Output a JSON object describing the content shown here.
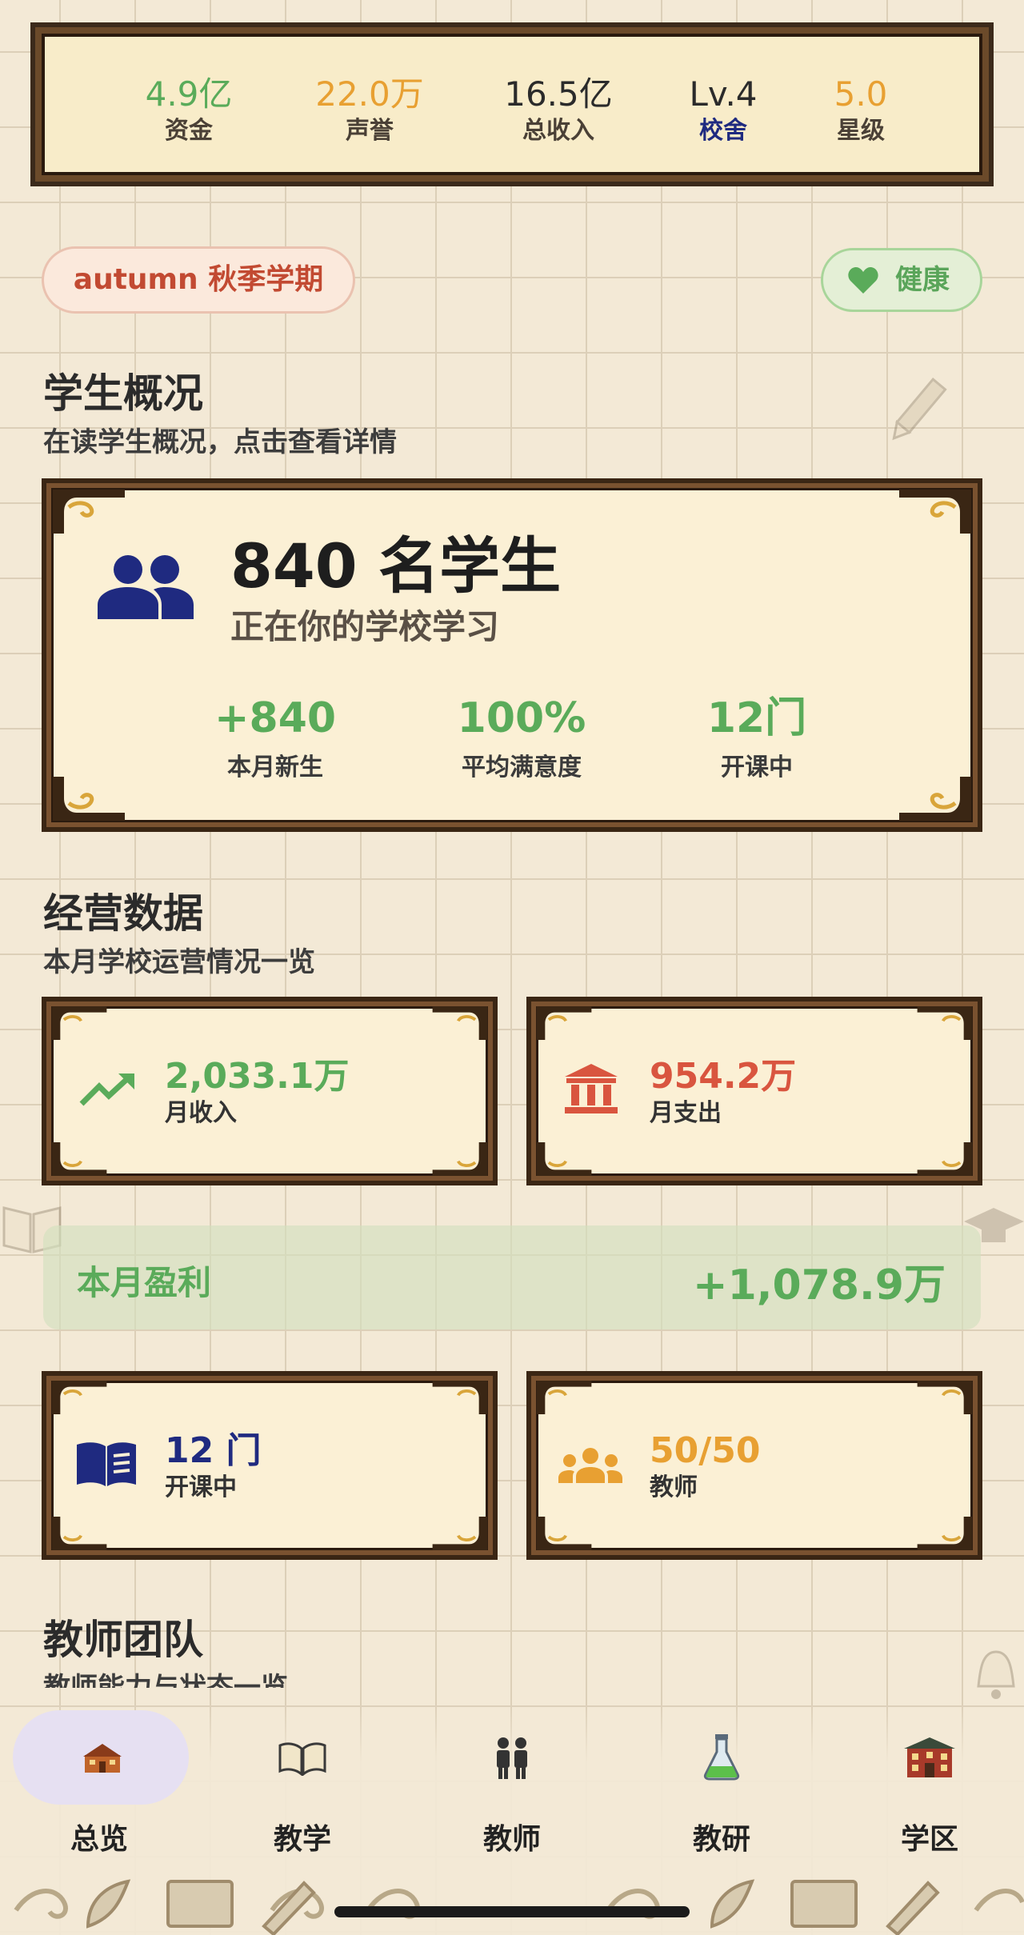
{
  "stats": [
    {
      "value": "4.9亿",
      "label": "资金",
      "value_color": "#5aab5a",
      "label_color": "#4a4036"
    },
    {
      "value": "22.0万",
      "label": "声誉",
      "value_color": "#e8a032",
      "label_color": "#4a4036"
    },
    {
      "value": "16.5亿",
      "label": "总收入",
      "value_color": "#2b2b2b",
      "label_color": "#4a4036"
    },
    {
      "value": "Lv.4",
      "label": "校舍",
      "value_color": "#2b2b2b",
      "label_color": "#1f2a80"
    },
    {
      "value": "5.0",
      "label": "星级",
      "value_color": "#e8a032",
      "label_color": "#4a4036"
    }
  ],
  "season_pill": "autumn 秋季学期",
  "health_pill": "健康",
  "students_section": {
    "title": "学生概况",
    "subtitle": "在读学生概况，点击查看详情",
    "count_text": "840 名学生",
    "count_sub": "正在你的学校学习",
    "metrics": [
      {
        "value": "+840",
        "label": "本月新生"
      },
      {
        "value": "100%",
        "label": "平均满意度"
      },
      {
        "value": "12门",
        "label": "开课中"
      }
    ]
  },
  "ops_section": {
    "title": "经营数据",
    "subtitle": "本月学校运营情况一览",
    "income": {
      "value": "2,033.1万",
      "label": "月收入",
      "color": "#5aab5a"
    },
    "expense": {
      "value": "954.2万",
      "label": "月支出",
      "color": "#d9553f"
    },
    "profit_label": "本月盈利",
    "profit_value": "+1,078.9万",
    "courses": {
      "value": "12 门",
      "label": "开课中",
      "color": "#1f2a80"
    },
    "teachers": {
      "value": "50/50",
      "label": "教师",
      "color": "#e8a032"
    }
  },
  "teacher_section": {
    "title": "教师团队",
    "subtitle": "教师能力与状态一览"
  },
  "nav": [
    {
      "label": "总览",
      "icon": "school-house-icon",
      "active": true
    },
    {
      "label": "教学",
      "icon": "open-book-icon",
      "active": false
    },
    {
      "label": "教师",
      "icon": "teachers-icon",
      "active": false
    },
    {
      "label": "教研",
      "icon": "flask-icon",
      "active": false
    },
    {
      "label": "学区",
      "icon": "campus-building-icon",
      "active": false
    }
  ]
}
